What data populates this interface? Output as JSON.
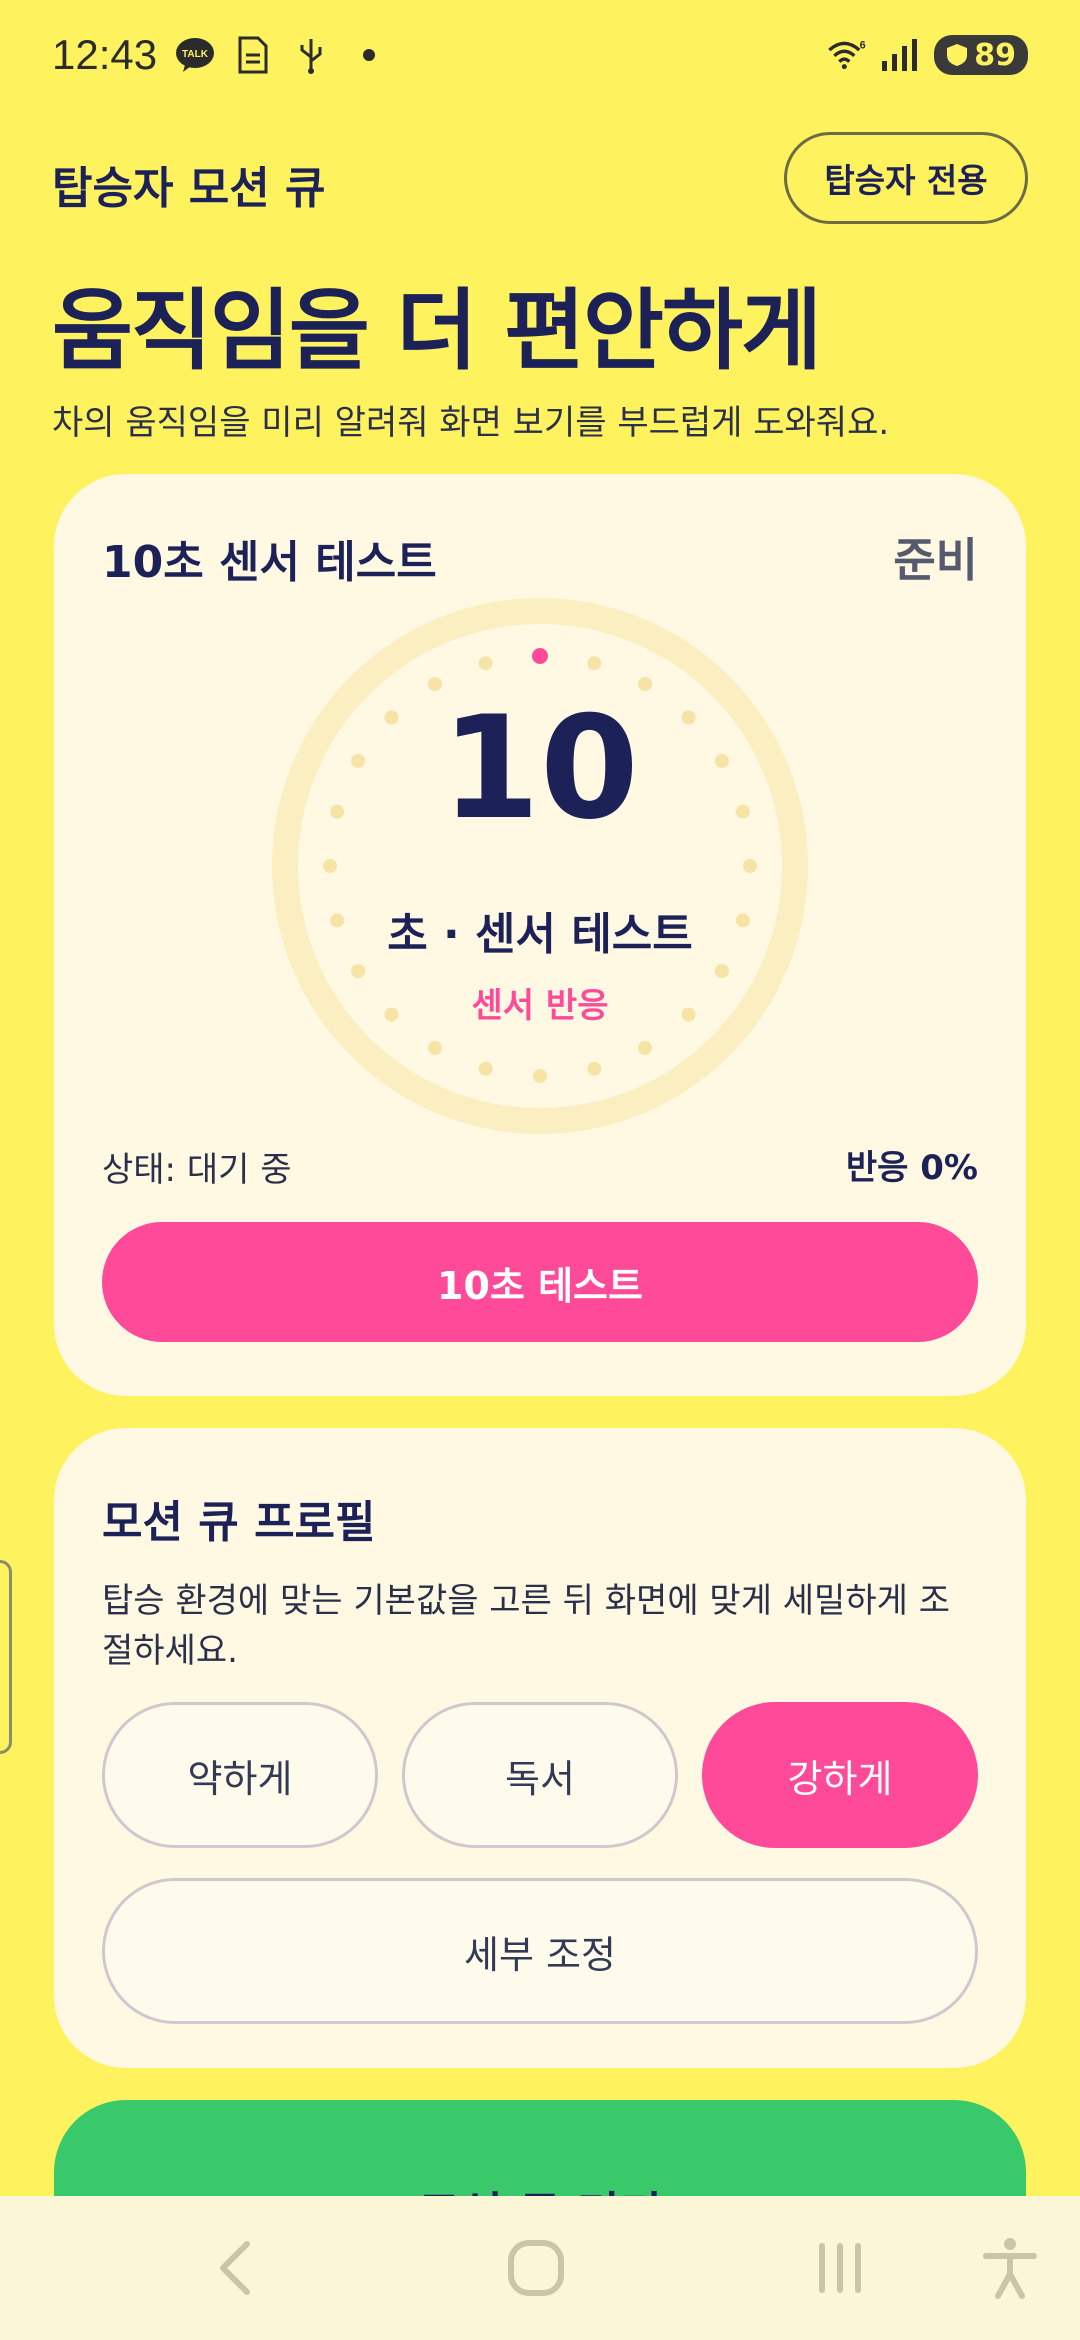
{
  "status_bar": {
    "time": "12:43",
    "icons": [
      "kakaotalk-icon",
      "document-icon",
      "usb-icon",
      "dot-icon"
    ],
    "right_icons": [
      "wifi-icon",
      "signal-icon"
    ],
    "wifi_label": "6",
    "battery": "89"
  },
  "header": {
    "app_title": "탑승자 모션 큐",
    "passenger_button": "탑승자 전용",
    "headline": "움직임을 더 편안하게",
    "subtitle": "차의 움직임을 미리 알려줘 화면 보기를 부드럽게 도와줘요."
  },
  "sensor_card": {
    "title": "10초 센서 테스트",
    "state": "준비",
    "countdown": "10",
    "dial_label": "초 · 센서 테스트",
    "dial_sub": "센서 반응",
    "status": "상태: 대기 중",
    "response": "반응 0%",
    "response_percent": 0,
    "test_button": "10초 테스트"
  },
  "profile_card": {
    "title": "모션 큐 프로필",
    "description": "탑승 환경에 맞는 기본값을 고른 뒤 화면에 맞게 세밀하게 조절하세요.",
    "options": [
      {
        "label": "약하게",
        "selected": false
      },
      {
        "label": "독서",
        "selected": false
      },
      {
        "label": "강하게",
        "selected": true
      }
    ],
    "fine_tune_button": "세부 조정"
  },
  "primary_action": {
    "label": "모션 큐 켜기"
  },
  "nav_bar": {
    "items": [
      "back-icon",
      "home-icon",
      "recents-icon",
      "accessibility-icon"
    ]
  },
  "colors": {
    "background": "#fff25f",
    "card": "#fff9e3",
    "accent_pink": "#ff4a9a",
    "primary_green": "#39c96a",
    "navy_text": "#1c2257"
  }
}
